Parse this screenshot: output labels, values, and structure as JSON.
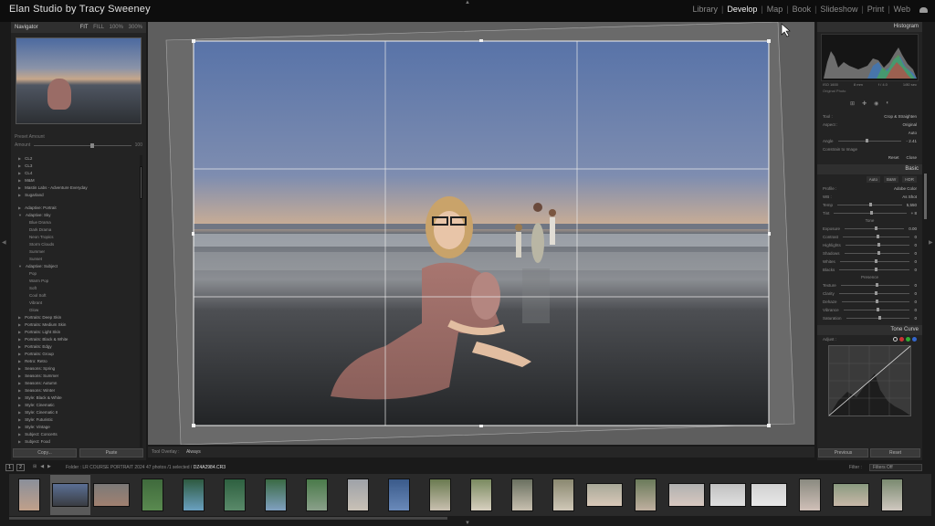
{
  "app": {
    "studio_title": "Elan Studio by Tracy Sweeney",
    "modules": [
      "Library",
      "Develop",
      "Map",
      "Book",
      "Slideshow",
      "Print",
      "Web"
    ],
    "active_module": "Develop"
  },
  "navigator": {
    "title": "Navigator",
    "zoom_options": [
      "FIT",
      "FILL",
      "100%",
      "300%"
    ]
  },
  "presets": {
    "header": "Preset Amount",
    "amount_label": "Amount",
    "amount_value": "100",
    "items": [
      {
        "label": "CL2",
        "child": false
      },
      {
        "label": "CL3",
        "child": false
      },
      {
        "label": "CL4",
        "child": false
      },
      {
        "label": "M&M",
        "child": false
      },
      {
        "label": "Mastin Labs - Adventure Everyday",
        "child": false
      },
      {
        "label": "Sugarland",
        "child": false
      },
      {
        "label": "Adaptive: Portrait",
        "child": false
      },
      {
        "label": "Adaptive: Sky",
        "child": false
      },
      {
        "label": "Blue Drama",
        "child": true
      },
      {
        "label": "Dark Drama",
        "child": true
      },
      {
        "label": "Neon Tropics",
        "child": true
      },
      {
        "label": "Storm Clouds",
        "child": true
      },
      {
        "label": "Summer",
        "child": true
      },
      {
        "label": "Sunset",
        "child": true
      },
      {
        "label": "Adaptive: Subject",
        "child": false
      },
      {
        "label": "Pop",
        "child": true
      },
      {
        "label": "Warm Pop",
        "child": true
      },
      {
        "label": "Soft",
        "child": true
      },
      {
        "label": "Cool Soft",
        "child": true
      },
      {
        "label": "Vibrant",
        "child": true
      },
      {
        "label": "Glow",
        "child": true
      },
      {
        "label": "Portraits: Deep Skin",
        "child": false
      },
      {
        "label": "Portraits: Medium Skin",
        "child": false
      },
      {
        "label": "Portraits: Light Skin",
        "child": false
      },
      {
        "label": "Portraits: Black & White",
        "child": false
      },
      {
        "label": "Portraits: Edgy",
        "child": false
      },
      {
        "label": "Portraits: Group",
        "child": false
      },
      {
        "label": "Retro: Retro",
        "child": false
      },
      {
        "label": "Seasons: Spring",
        "child": false
      },
      {
        "label": "Seasons: Summer",
        "child": false
      },
      {
        "label": "Seasons: Autumn",
        "child": false
      },
      {
        "label": "Seasons: Winter",
        "child": false
      },
      {
        "label": "Style: Black & White",
        "child": false
      },
      {
        "label": "Style: Cinematic",
        "child": false
      },
      {
        "label": "Style: Cinematic II",
        "child": false
      },
      {
        "label": "Style: Futuristic",
        "child": false
      },
      {
        "label": "Style: Vintage",
        "child": false
      },
      {
        "label": "Subject: Concerts",
        "child": false
      },
      {
        "label": "Subject: Food",
        "child": false
      }
    ],
    "copy_label": "Copy...",
    "paste_label": "Paste"
  },
  "center": {
    "tool_overlay_label": "Tool Overlay :",
    "tool_overlay_value": "Always"
  },
  "histogram": {
    "title": "Histogram",
    "info": [
      "ISO 1600",
      "8 mm",
      "f / 4.0",
      "1/80 sec"
    ],
    "original_photo": "Original Photo"
  },
  "crop": {
    "tool_label": "Tool :",
    "tool_value": "Crop & Straighten",
    "aspect_label": "Aspect :",
    "aspect_value": "Original",
    "auto_label": "Auto",
    "angle_label": "Angle",
    "angle_value": "- 2.41",
    "constrain_label": "Constrain to Image",
    "reset_label": "Reset",
    "close_label": "Close"
  },
  "basic": {
    "title": "Basic",
    "buttons": [
      "Auto",
      "B&W",
      "HDR"
    ],
    "profile_label": "Profile :",
    "profile_value": "Adobe Color",
    "wb_label": "WB :",
    "wb_value": "As Shot",
    "temp_label": "Temp",
    "temp_value": "5,550",
    "tint_label": "Tint",
    "tint_value": "+ 8",
    "tone_label": "Tone",
    "tone_rows": [
      {
        "label": "Exposure",
        "value": "0.00"
      },
      {
        "label": "Contrast",
        "value": "0"
      },
      {
        "label": "Highlights",
        "value": "0"
      },
      {
        "label": "Shadows",
        "value": "0"
      },
      {
        "label": "Whites",
        "value": "0"
      },
      {
        "label": "Blacks",
        "value": "0"
      }
    ],
    "presence_label": "Presence",
    "presence_rows": [
      {
        "label": "Texture",
        "value": "0"
      },
      {
        "label": "Clarity",
        "value": "0"
      },
      {
        "label": "Dehaze",
        "value": "0"
      },
      {
        "label": "Vibrance",
        "value": "0"
      },
      {
        "label": "Saturation",
        "value": "0"
      }
    ]
  },
  "tone_curve": {
    "title": "Tone Curve",
    "adjust_label": "Adjust :"
  },
  "right_buttons": {
    "previous": "Previous",
    "reset": "Reset"
  },
  "filmstrip": {
    "btn1": "1",
    "btn2": "2",
    "folder": "Folder : LR COURSE PORTRAIT 2024",
    "count": "47 photos /1 selected /",
    "selected_file": "DZ4A2984.CR3",
    "filter_label": "Filter :",
    "filter_value": "Filters Off",
    "selected_index": 1
  }
}
